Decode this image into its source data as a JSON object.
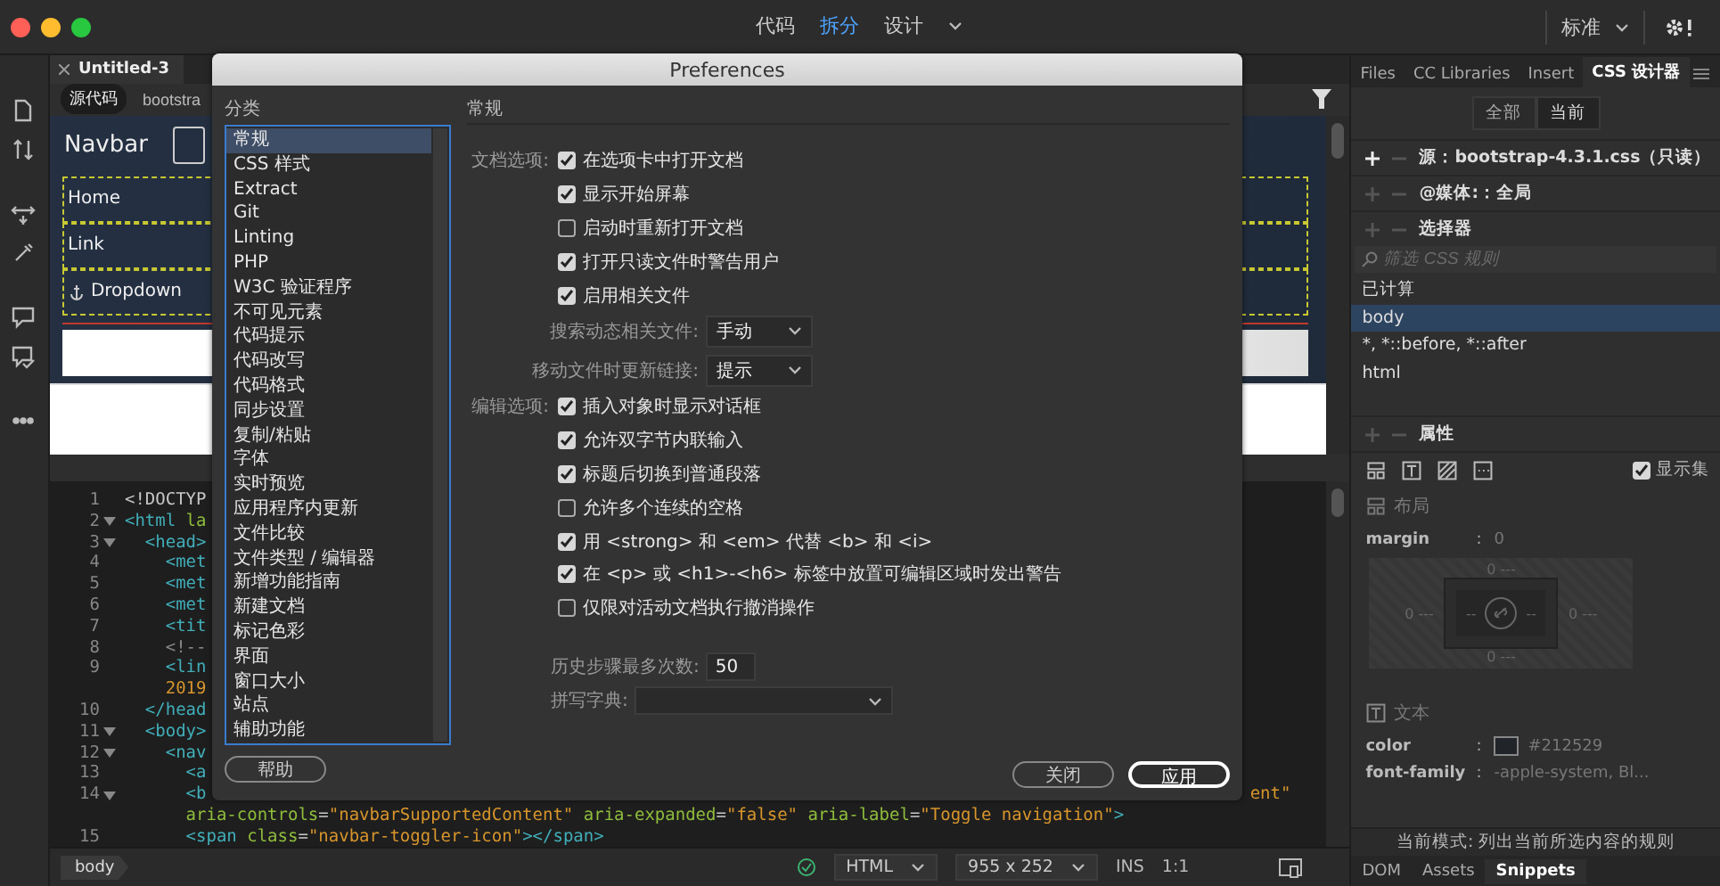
{
  "view_modes": [
    {
      "label": "代码",
      "selected": false
    },
    {
      "label": "拆分",
      "selected": true
    },
    {
      "label": "设计",
      "selected": false
    }
  ],
  "workspace": "标准",
  "document_tab": {
    "title": "Untitled-3"
  },
  "source_tabs": [
    {
      "label": "源代码",
      "selected": true
    },
    {
      "label": "bootstra",
      "selected": false
    }
  ],
  "design_view": {
    "brand": "Navbar",
    "nav_items": [
      {
        "label": "Home",
        "kind": "link"
      },
      {
        "label": "Link",
        "kind": "link"
      },
      {
        "label": "Dropdown",
        "kind": "dropdown"
      }
    ]
  },
  "code": {
    "lines": [
      {
        "number": "1",
        "foldable": false,
        "tokens": [
          {
            "text": "<!DOCTYP",
            "kind": "doctype"
          }
        ]
      },
      {
        "number": "2",
        "foldable": true,
        "tokens": [
          {
            "text": "<html",
            "kind": "tag"
          },
          {
            "text": " la",
            "kind": "attr"
          }
        ]
      },
      {
        "number": "3",
        "foldable": true,
        "tokens": [
          {
            "text": "  <head>",
            "kind": "tag"
          }
        ]
      },
      {
        "number": "4",
        "foldable": false,
        "tokens": [
          {
            "text": "    <met",
            "kind": "tag"
          }
        ]
      },
      {
        "number": "5",
        "foldable": false,
        "tokens": [
          {
            "text": "    <met",
            "kind": "tag"
          }
        ]
      },
      {
        "number": "6",
        "foldable": false,
        "tokens": [
          {
            "text": "    <met",
            "kind": "tag"
          }
        ]
      },
      {
        "number": "7",
        "foldable": false,
        "tokens": [
          {
            "text": "    <tit",
            "kind": "tag"
          }
        ]
      },
      {
        "number": "8",
        "foldable": false,
        "tokens": [
          {
            "text": "    <!--",
            "kind": "comment"
          }
        ]
      },
      {
        "number": "9",
        "foldable": false,
        "tokens": [
          {
            "text": "    <lin",
            "kind": "tag"
          }
        ]
      },
      {
        "foldable": false,
        "tokens": [
          {
            "text": "    2019",
            "kind": "string"
          }
        ]
      },
      {
        "number": "10",
        "foldable": false,
        "tokens": [
          {
            "text": "  </head",
            "kind": "tag"
          }
        ]
      },
      {
        "number": "11",
        "foldable": true,
        "tokens": [
          {
            "text": "  <body>",
            "kind": "tag"
          }
        ]
      },
      {
        "number": "12",
        "foldable": true,
        "tokens": [
          {
            "text": "    <nav",
            "kind": "tag"
          }
        ]
      },
      {
        "number": "13",
        "foldable": false,
        "tokens": [
          {
            "text": "      <a",
            "kind": "tag"
          }
        ]
      },
      {
        "number": "14",
        "foldable": true,
        "tokens": [
          {
            "text": "      <b",
            "kind": "tag"
          }
        ],
        "tail": "ent\""
      },
      {
        "foldable": false,
        "tokens": [
          {
            "text": "      aria-controls",
            "kind": "attr"
          },
          {
            "text": "=",
            "kind": "punct"
          },
          {
            "text": "\"navbarSupportedContent\"",
            "kind": "string"
          },
          {
            "text": " aria-expanded",
            "kind": "attr"
          },
          {
            "text": "=",
            "kind": "punct"
          },
          {
            "text": "\"false\"",
            "kind": "string"
          },
          {
            "text": " aria-label",
            "kind": "attr"
          },
          {
            "text": "=",
            "kind": "punct"
          },
          {
            "text": "\"Toggle navigation\"",
            "kind": "string"
          },
          {
            "text": ">",
            "kind": "tag"
          }
        ]
      },
      {
        "number": "15",
        "foldable": false,
        "tokens": [
          {
            "text": "      <span",
            "kind": "tag"
          },
          {
            "text": " class",
            "kind": "attr"
          },
          {
            "text": "=",
            "kind": "punct"
          },
          {
            "text": "\"navbar-toggler-icon\"",
            "kind": "string"
          },
          {
            "text": "></span>",
            "kind": "tag"
          }
        ]
      }
    ]
  },
  "status_bar": {
    "tag": "body",
    "language": "HTML",
    "size": "955 x 252",
    "mode": "INS",
    "zoom": "1:1"
  },
  "panel_tabs": [
    {
      "label": "Files",
      "selected": false
    },
    {
      "label": "CC Libraries",
      "selected": false
    },
    {
      "label": "Insert",
      "selected": false
    },
    {
      "label": "CSS 设计器",
      "selected": true
    }
  ],
  "css_designer": {
    "scope": [
      {
        "label": "全部",
        "selected": false
      },
      {
        "label": "当前",
        "selected": true
      }
    ],
    "sections": [
      {
        "title": "源：bootstrap-4.3.1.css（只读）",
        "add_enabled": true
      },
      {
        "title": "@媒体:：全局",
        "add_enabled": false
      },
      {
        "title": "选择器",
        "add_enabled": false
      }
    ],
    "filter_placeholder": "筛选 CSS 规则",
    "selectors": [
      {
        "label": "已计算",
        "selected": false
      },
      {
        "label": "body",
        "selected": true
      },
      {
        "label": "*, *::before, *::after",
        "selected": false
      },
      {
        "label": "html",
        "selected": false
      }
    ],
    "properties_title": "属性",
    "show_set": {
      "label": "显示集",
      "checked": true
    },
    "layout_title": "布局",
    "margin": {
      "name": "margin",
      "separator": ":",
      "value": "0"
    },
    "box": {
      "top": "0 ---",
      "left": "0 ---",
      "right": "0 ---",
      "bottom": "0 ---",
      "inner_left": "--",
      "inner_right": "--"
    },
    "text_title": "文本",
    "properties": [
      {
        "kind": "color",
        "name": "color",
        "separator": ":",
        "value": "#212529"
      },
      {
        "kind": "text",
        "name": "font-family",
        "separator": ":",
        "value": "-apple-system, Bl..."
      }
    ],
    "mode_note": "当前模式: 列出当前所选内容的规则"
  },
  "bottom_tabs": [
    {
      "label": "DOM",
      "selected": false
    },
    {
      "label": "Assets",
      "selected": false
    },
    {
      "label": "Snippets",
      "selected": true
    }
  ],
  "preferences": {
    "title": "Preferences",
    "category_label": "分类",
    "categories": [
      {
        "label": "常规",
        "selected": true
      },
      {
        "label": "CSS 样式",
        "selected": false
      },
      {
        "label": "Extract",
        "selected": false
      },
      {
        "label": "Git",
        "selected": false
      },
      {
        "label": "Linting",
        "selected": false
      },
      {
        "label": "PHP",
        "selected": false
      },
      {
        "label": "W3C 验证程序",
        "selected": false
      },
      {
        "label": "不可见元素",
        "selected": false
      },
      {
        "label": "代码提示",
        "selected": false
      },
      {
        "label": "代码改写",
        "selected": false
      },
      {
        "label": "代码格式",
        "selected": false
      },
      {
        "label": "同步设置",
        "selected": false
      },
      {
        "label": "复制/粘贴",
        "selected": false
      },
      {
        "label": "字体",
        "selected": false
      },
      {
        "label": "实时预览",
        "selected": false
      },
      {
        "label": "应用程序内更新",
        "selected": false
      },
      {
        "label": "文件比较",
        "selected": false
      },
      {
        "label": "文件类型 / 编辑器",
        "selected": false
      },
      {
        "label": "新增功能指南",
        "selected": false
      },
      {
        "label": "新建文档",
        "selected": false
      },
      {
        "label": "标记色彩",
        "selected": false
      },
      {
        "label": "界面",
        "selected": false
      },
      {
        "label": "窗口大小",
        "selected": false
      },
      {
        "label": "站点",
        "selected": false
      },
      {
        "label": "辅助功能",
        "selected": false
      }
    ],
    "section_title": "常规",
    "rows": [
      {
        "kind": "checkbox",
        "group_label": "文档选项:",
        "label": "在选项卡中打开文档",
        "checked": true
      },
      {
        "kind": "checkbox",
        "label": "显示开始屏幕",
        "checked": true
      },
      {
        "kind": "checkbox",
        "label": "启动时重新打开文档",
        "checked": false
      },
      {
        "kind": "checkbox",
        "label": "打开只读文件时警告用户",
        "checked": true
      },
      {
        "kind": "checkbox",
        "label": "启用相关文件",
        "checked": true
      },
      {
        "kind": "dropdown",
        "label": "搜索动态相关文件:",
        "value": "手动"
      },
      {
        "kind": "dropdown",
        "label": "移动文件时更新链接:",
        "value": "提示"
      },
      {
        "kind": "checkbox",
        "group_label": "编辑选项:",
        "label": "插入对象时显示对话框",
        "checked": true
      },
      {
        "kind": "checkbox",
        "label": "允许双字节内联输入",
        "checked": true
      },
      {
        "kind": "checkbox",
        "label": "标题后切换到普通段落",
        "checked": true
      },
      {
        "kind": "checkbox",
        "label": "允许多个连续的空格",
        "checked": false
      },
      {
        "kind": "checkbox",
        "label": "用 <strong> 和 <em> 代替 <b> 和 <i>",
        "checked": true
      },
      {
        "kind": "checkbox",
        "label": "在 <p> 或 <h1>-<h6> 标签中放置可编辑区域时发出警告",
        "checked": true
      },
      {
        "kind": "checkbox",
        "label": "仅限对活动文档执行撤消操作",
        "checked": false
      },
      {
        "kind": "number",
        "label": "历史步骤最多次数:",
        "value": "50"
      },
      {
        "kind": "picker",
        "label": "拼写字典:"
      }
    ],
    "help_button": "帮助",
    "buttons": [
      {
        "label": "关闭",
        "default": false
      },
      {
        "label": "应用",
        "default": true
      }
    ]
  }
}
